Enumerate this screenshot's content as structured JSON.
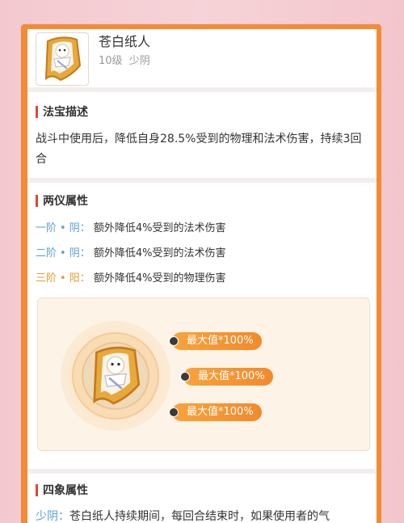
{
  "item": {
    "name": "苍白纸人",
    "level": "10级",
    "type": "少阴",
    "icon": "paper-doll-icon"
  },
  "description": {
    "title": "法宝描述",
    "text": "战斗中使用后，降低自身28.5%受到的物理和法术伤害，持续3回合"
  },
  "dual": {
    "title": "两仪属性",
    "rows": [
      {
        "level": "一阶",
        "dot": "•",
        "kind": "阴",
        "colon": "：",
        "text": "额外降低4%受到的法术伤害"
      },
      {
        "level": "二阶",
        "dot": "•",
        "kind": "阴",
        "colon": "：",
        "text": "额外降低4%受到的法术伤害"
      },
      {
        "level": "三阶",
        "dot": "•",
        "kind": "阳",
        "colon": "：",
        "text": "额外降低4%受到的物理伤害"
      }
    ],
    "pills": [
      "最大值*100%",
      "最大值*100%",
      "最大值*100%"
    ]
  },
  "four": {
    "title": "四象属性",
    "label": "少阴：",
    "text": "苍白纸人持续期间，每回合结束时，如果使用者的气"
  },
  "colors": {
    "frame": "#f58a34",
    "accent_bar": "#e0463c",
    "yin_blue": "#5aa0da",
    "yang_orange": "#e69a2c",
    "pill": "#f18a2c"
  }
}
